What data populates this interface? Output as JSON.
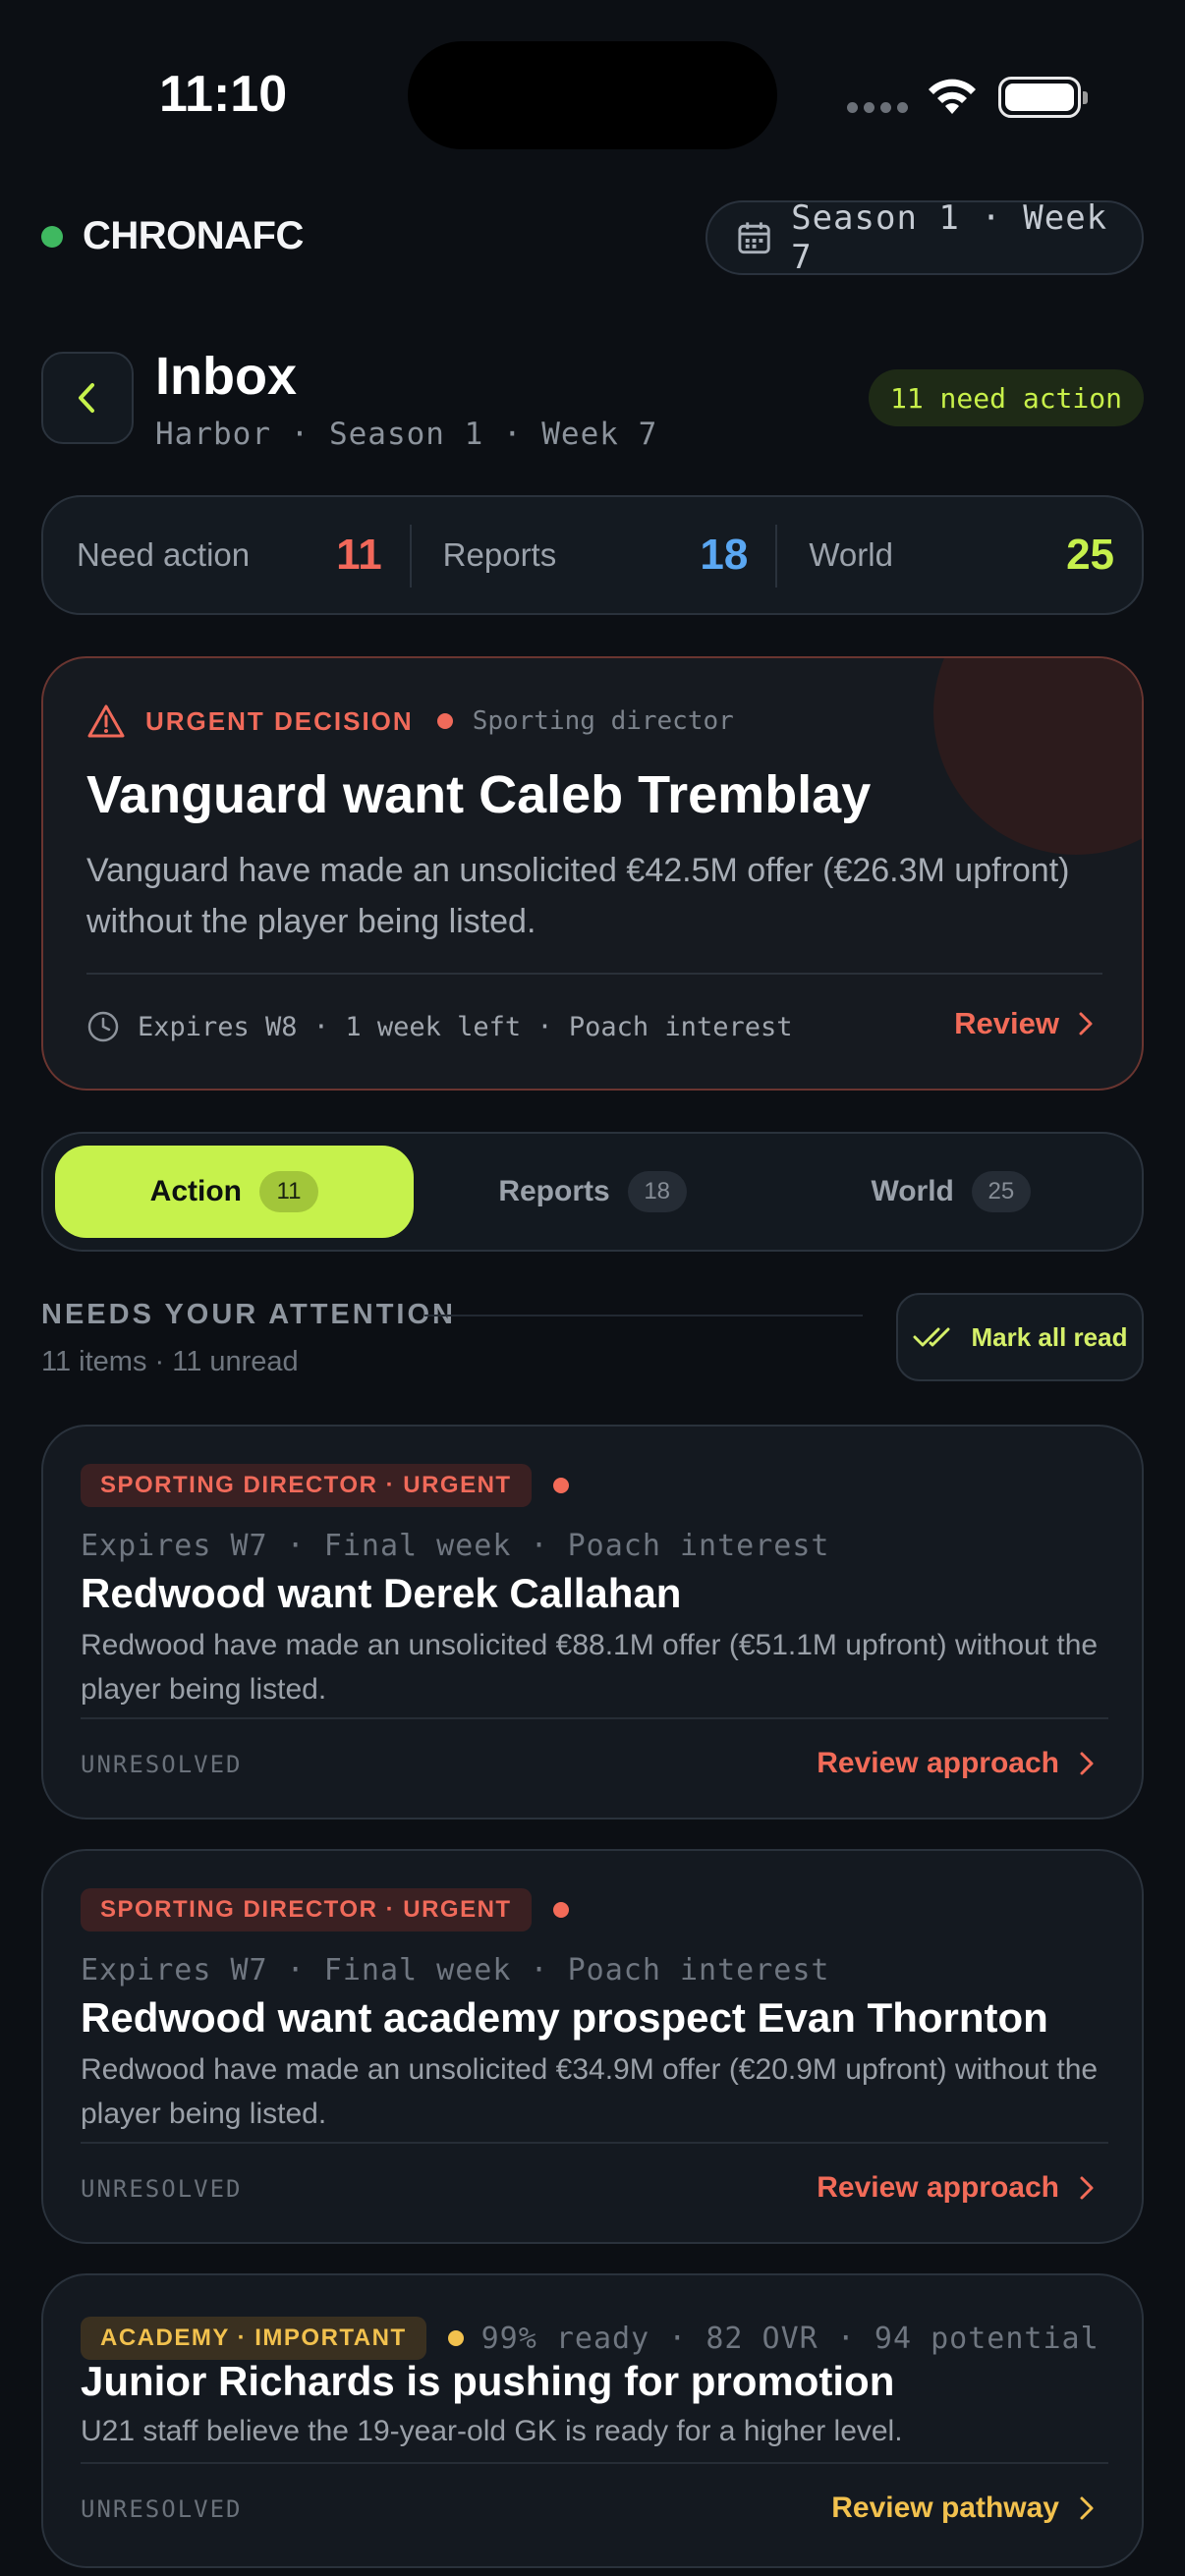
{
  "status_bar": {
    "time": "11:10"
  },
  "brand": {
    "name": "CHRONAFC",
    "season_pill": "Season 1 · Week 7"
  },
  "header": {
    "title": "Inbox",
    "subtitle": "Harbor · Season 1 · Week 7",
    "need_action_badge": "11 need action"
  },
  "stats": [
    {
      "label": "Need action",
      "value": "11",
      "color": "#f2685a"
    },
    {
      "label": "Reports",
      "value": "18",
      "color": "#5aa7f2"
    },
    {
      "label": "World",
      "value": "25",
      "color": "#c6f04c"
    }
  ],
  "urgent": {
    "tag": "URGENT DECISION",
    "from": "Sporting director",
    "title": "Vanguard want Caleb Tremblay",
    "body": "Vanguard have made an unsolicited €42.5M offer (€26.3M upfront) without the player being listed.",
    "footer": "Expires W8 · 1 week left · Poach interest",
    "action": "Review"
  },
  "tabs": [
    {
      "label": "Action",
      "count": "11"
    },
    {
      "label": "Reports",
      "count": "18"
    },
    {
      "label": "World",
      "count": "25"
    }
  ],
  "section": {
    "title": "NEEDS YOUR ATTENTION",
    "subtitle": "11 items · 11 unread",
    "mark_all_read": "Mark all read"
  },
  "cards": [
    {
      "badge": "SPORTING DIRECTOR · URGENT",
      "meta": "Expires W7 · Final week · Poach interest",
      "title": "Redwood want Derek Callahan",
      "body": "Redwood have made an unsolicited €88.1M offer (€51.1M upfront) without the player being listed.",
      "status": "UNRESOLVED",
      "action": "Review approach"
    },
    {
      "badge": "SPORTING DIRECTOR · URGENT",
      "meta": "Expires W7 · Final week · Poach interest",
      "title": "Redwood want academy prospect Evan Thornton",
      "body": "Redwood have made an unsolicited €34.9M offer (€20.9M upfront) without the player being listed.",
      "status": "UNRESOLVED",
      "action": "Review approach"
    },
    {
      "badge": "ACADEMY · IMPORTANT",
      "meta": "99% ready · 82 OVR · 94 potential",
      "title": "Junior Richards is pushing for promotion",
      "body": "U21 staff believe the 19-year-old GK is ready for a higher level.",
      "status": "UNRESOLVED",
      "action": "Review pathway"
    }
  ],
  "colors": {
    "accent": "#c6f24c",
    "urgent": "#f26b58",
    "important": "#f2c14e"
  }
}
